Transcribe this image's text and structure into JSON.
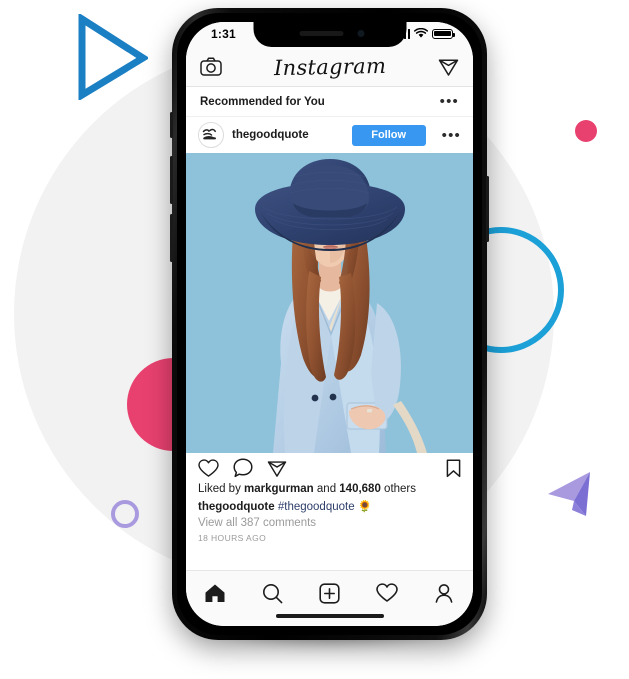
{
  "device": {
    "name": "smartphone-mockup",
    "status_bar": {
      "time": "1:31",
      "signal_icon": "cellular-signal-icon",
      "wifi_icon": "wifi-icon",
      "battery_icon": "battery-icon"
    },
    "home_indicator": "home-indicator"
  },
  "app": {
    "name": "Instagram",
    "header": {
      "logo_text": "Instagram",
      "camera_icon": "camera-icon",
      "direct_message_icon": "paper-plane-icon"
    },
    "recommendation": {
      "title": "Recommended for You",
      "more_label": "•••"
    },
    "post": {
      "avatar_icon": "user-avatar",
      "username": "thegoodquote",
      "follow_label": "Follow",
      "more_label": "•••",
      "image_alt": "woman-in-blue-hat-and-sunglasses",
      "actions": {
        "like_icon": "heart-icon",
        "comment_icon": "comment-bubble-icon",
        "share_icon": "paper-plane-icon",
        "save_icon": "bookmark-icon"
      },
      "likes_prefix": "Liked by ",
      "likes_user": "markgurman",
      "likes_middle": " and ",
      "likes_count": "140,680",
      "likes_suffix": " others",
      "caption_user": "thegoodquote",
      "caption_hashtag": "#thegoodquote",
      "caption_emoji": "🌻",
      "comments_label": "View all 387 comments",
      "timestamp": "18 HOURS AGO"
    },
    "tabbar": {
      "items": [
        {
          "name": "home",
          "icon": "home-icon",
          "active": true
        },
        {
          "name": "search",
          "icon": "search-icon",
          "active": false
        },
        {
          "name": "create",
          "icon": "plus-square-icon",
          "active": false
        },
        {
          "name": "activity",
          "icon": "heart-icon",
          "active": false
        },
        {
          "name": "profile",
          "icon": "person-icon",
          "active": false
        }
      ]
    }
  },
  "decorations": {
    "backdrop_circle": "light-gray-circle",
    "triangle_blue": "blue-outline-triangle",
    "ring_cyan": "cyan-ring",
    "dot_pink": "pink-dot",
    "circle_pink": "pink-circle",
    "ring_purple": "purple-ring",
    "triangle_purple": "purple-triangle"
  },
  "colors": {
    "instagram_blue": "#3897f0",
    "accent_blue": "#1b7fc4",
    "accent_cyan": "#1ba0d8",
    "accent_pink": "#e8416f",
    "accent_purple": "#a99ae0",
    "accent_purple_dark": "#7b6fd4",
    "photo_background": "#8dc2da",
    "backdrop_gray": "#f2f2f2"
  }
}
